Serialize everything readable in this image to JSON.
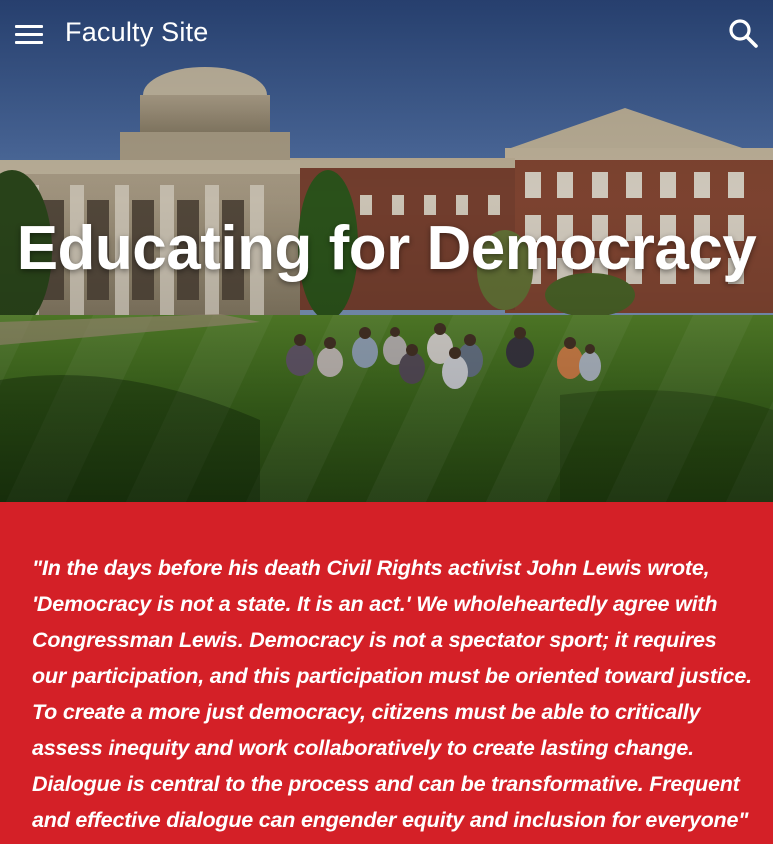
{
  "header": {
    "site_title": "Faculty Site",
    "menu_icon": "hamburger-menu-icon",
    "search_icon": "search-icon"
  },
  "hero": {
    "heading": "Educating for Democracy"
  },
  "quote": {
    "text": "\"In the days before his death Civil Rights activist John Lewis wrote, 'Democracy is not a state. It is an act.' We wholeheartedly agree with Congressman Lewis. Democracy is not a spectator sport; it requires our participation, and this participation must be oriented toward justice. To create a more just democracy, citizens must be able to critically assess inequity and work collaboratively to create lasting change. Dialogue is central to the process and can be transformative. Frequent and effective dialogue can engender equity and inclusion for everyone\" (University of"
  },
  "colors": {
    "accent_red": "#d42027",
    "header_text": "#ffffff"
  }
}
